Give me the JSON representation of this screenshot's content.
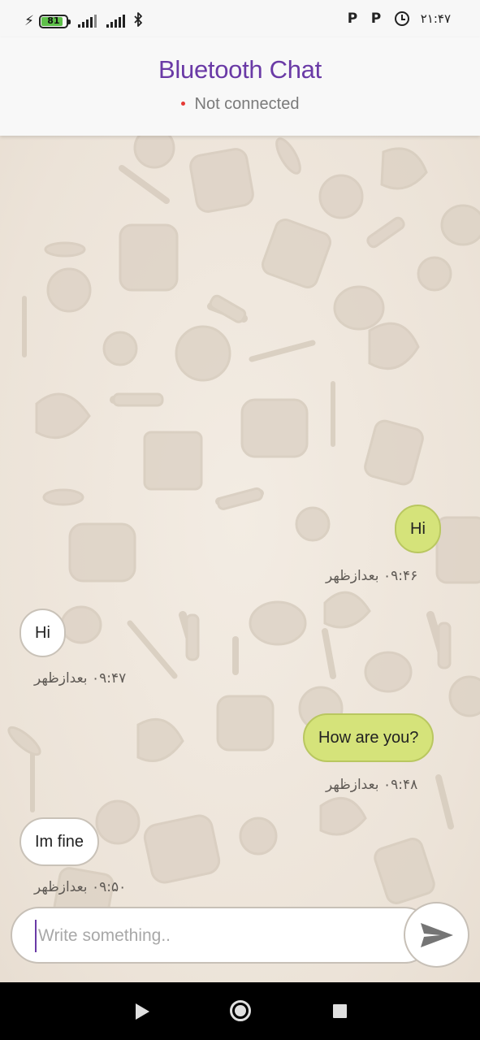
{
  "status_bar": {
    "battery_level": "81",
    "time": "۲۱:۴۷",
    "icons": [
      "charging-bolt-icon",
      "battery-icon",
      "signal-icon",
      "signal-icon",
      "bluetooth-icon",
      "parking-notification-icon",
      "parking-notification-icon",
      "alarm-icon"
    ]
  },
  "app_bar": {
    "title": "Bluetooth Chat",
    "connection_status": "Not connected",
    "title_color": "#6a3aa6",
    "status_dot_color": "#e53935"
  },
  "messages": [
    {
      "direction": "outgoing",
      "text": "Hi",
      "time": "۰۹:۴۶ بعدازظهر"
    },
    {
      "direction": "incoming",
      "text": "Hi",
      "time": "۰۹:۴۷ بعدازظهر"
    },
    {
      "direction": "outgoing",
      "text": "How are you?",
      "time": "۰۹:۴۸ بعدازظهر"
    },
    {
      "direction": "incoming",
      "text": "Im fine",
      "time": "۰۹:۵۰ بعدازظهر"
    }
  ],
  "composer": {
    "placeholder": "Write something..",
    "value": "",
    "send_icon": "send-icon"
  },
  "colors": {
    "outgoing_bubble": "#d5e37a",
    "incoming_bubble": "#ffffff",
    "chat_background": "#efe7dd"
  },
  "nav_bar": {
    "icons": [
      "back-icon",
      "home-icon",
      "recents-icon"
    ]
  }
}
